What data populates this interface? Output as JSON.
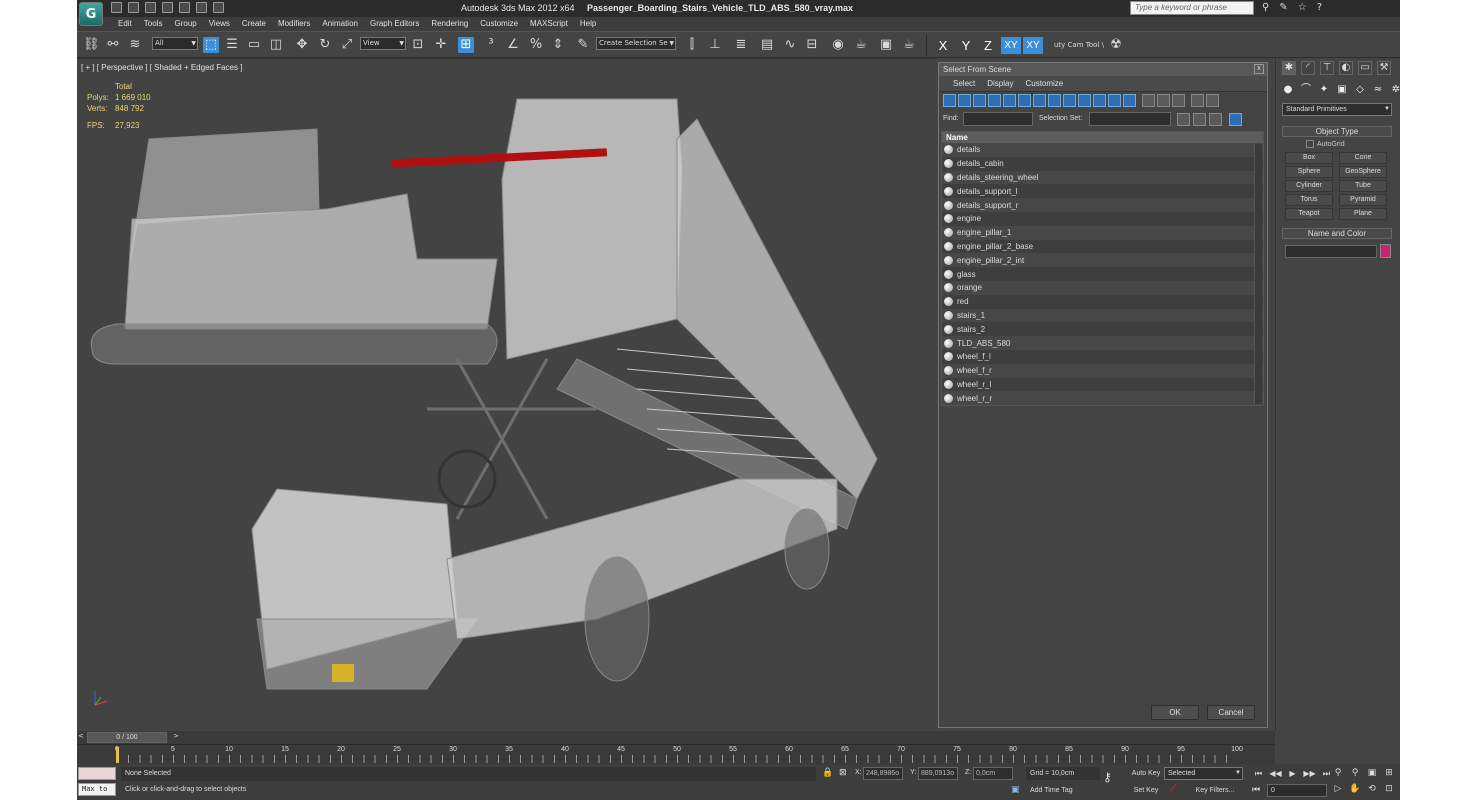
{
  "title_bar": {
    "app_logo": "G",
    "app_name": "Autodesk 3ds Max  2012 x64",
    "file_name": "Passenger_Boarding_Stairs_Vehicle_TLD_ABS_580_vray.max",
    "search_placeholder": "Type a keyword or phrase"
  },
  "menu": {
    "items": [
      "Edit",
      "Tools",
      "Group",
      "Views",
      "Create",
      "Modifiers",
      "Animation",
      "Graph Editors",
      "Rendering",
      "Customize",
      "MAXScript",
      "Help"
    ]
  },
  "toolbar": {
    "selection_filter": "All",
    "reference_coord": "View",
    "named_selection": "Create Selection Se",
    "axis_x": "X",
    "axis_y": "Y",
    "axis_z": "Z",
    "axis_xy": "XY",
    "axis_xy2": "XY",
    "caddy_label": "uty Cam Tool \\"
  },
  "viewport": {
    "label": "[ + ] [ Perspective ] [ Shaded + Edged Faces ]",
    "stats_header": "Total",
    "polys_label": "Polys:",
    "polys_value": "1 669 010",
    "verts_label": "Verts:",
    "verts_value": "848 792",
    "fps_label": "FPS:",
    "fps_value": "27,923"
  },
  "dialog": {
    "title": "Select From Scene",
    "close_glyph": "x",
    "menu": [
      "Select",
      "Display",
      "Customize"
    ],
    "find_label": "Find:",
    "selection_set_label": "Selection Set:",
    "column_name": "Name",
    "objects": [
      "details",
      "details_cabin",
      "details_steering_wheel",
      "details_support_l",
      "details_support_r",
      "engine",
      "engine_pillar_1",
      "engine_pillar_2_base",
      "engine_pillar_2_int",
      "glass",
      "orange",
      "red",
      "stairs_1",
      "stairs_2",
      "TLD_ABS_580",
      "wheel_f_l",
      "wheel_f_r",
      "wheel_r_l",
      "wheel_r_r"
    ],
    "ok_label": "OK",
    "cancel_label": "Cancel"
  },
  "command_panel": {
    "category": "Standard Primitives",
    "object_type_title": "Object Type",
    "autogrid_label": "AutoGrid",
    "primitives": [
      "Box",
      "Cone",
      "Sphere",
      "GeoSphere",
      "Cylinder",
      "Tube",
      "Torus",
      "Pyramid",
      "Teapot",
      "Plane"
    ],
    "name_color_title": "Name and Color",
    "object_color": "#c8256f"
  },
  "timeline": {
    "slider_label": "0 / 100",
    "prev": "<",
    "next": ">",
    "ticks": [
      "0",
      "5",
      "10",
      "15",
      "20",
      "25",
      "30",
      "35",
      "40",
      "45",
      "50",
      "55",
      "60",
      "65",
      "70",
      "75",
      "80",
      "85",
      "90",
      "95",
      "100"
    ]
  },
  "status": {
    "maxscript_label": "Max to",
    "selection_status": "None Selected",
    "prompt": "Click or click-and-drag to select objects",
    "x_label": "X:",
    "x_value": "248,8986o",
    "y_label": "Y:",
    "y_value": "889,0913o",
    "z_label": "Z:",
    "z_value": "0,0cm",
    "grid": "Grid = 10,0cm",
    "add_time_tag": "Add Time Tag",
    "auto_key": "Auto Key",
    "set_key": "Set Key",
    "key_mode": "Selected",
    "key_filters": "Key Filters...",
    "frame": "0"
  },
  "colors": {
    "accent": "#3b8fd6",
    "stats_text": "#e8d96b",
    "viewport_bg": "#434343"
  }
}
